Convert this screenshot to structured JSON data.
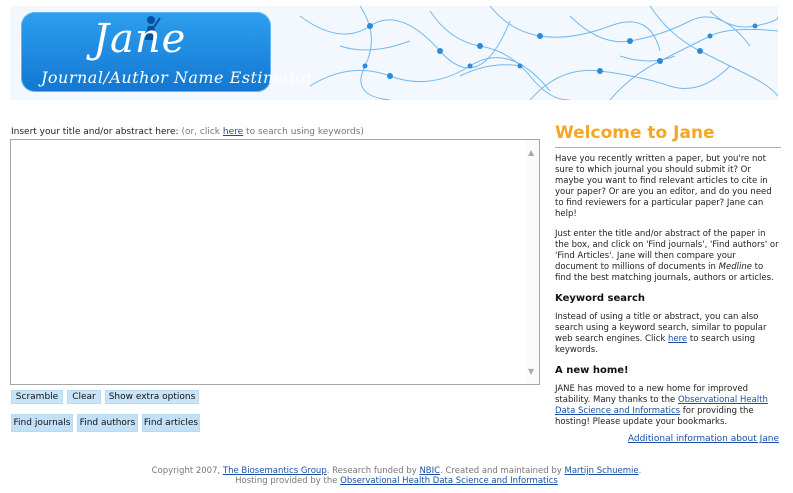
{
  "logo": {
    "word": "Jane",
    "subtitle": "Journal/Author Name Estimator"
  },
  "input": {
    "label": "Insert your title and/or abstract here:",
    "hint_prefix": "(or, click",
    "hint_link": "here",
    "hint_suffix": "to search using keywords)",
    "value": ""
  },
  "buttons": {
    "scramble": "Scramble",
    "clear": "Clear",
    "show_extra": "Show extra options",
    "find_journals": "Find journals",
    "find_authors": "Find authors",
    "find_articles": "Find articles"
  },
  "sidebar": {
    "title": "Welcome to Jane",
    "intro": "Have you recently written a paper, but you're not sure to which journal you should submit it? Or maybe you want to find relevant articles to cite in your paper? Or are you an editor, and do you need to find reviewers for a particular paper? Jane can help!",
    "how_before": "Just enter the title and/or abstract of the paper in the box, and click on 'Find journals', 'Find authors' or 'Find Articles'. Jane will then compare your document to millions of documents in",
    "how_medline": "Medline",
    "how_after": "to find the best matching journals, authors or articles.",
    "keyword_heading": "Keyword search",
    "keyword_before": "Instead of using a title or abstract, you can also search using a keyword search, similar to popular web search engines. Click",
    "keyword_link": "here",
    "keyword_after": "to search using keywords.",
    "home_heading": "A new home!",
    "home_before": "JANE has moved to a new home for improved stability. Many thanks to the",
    "home_link": "Observational Health Data Science and Informatics",
    "home_after": "for providing the hosting! Please update your bookmarks.",
    "more_info": "Additional information about Jane"
  },
  "footer": {
    "line1_a": "Copyright 2007,",
    "line1_link1": "The Biosemantics Group",
    "line1_b": ". Research funded by",
    "line1_link2": "NBIC",
    "line1_c": ". Created and maintained by",
    "line1_link3": "Martijn Schuemie",
    "line1_d": ".",
    "line2_a": "Hosting provided by the",
    "line2_link": "Observational Health Data Science and Informatics"
  }
}
